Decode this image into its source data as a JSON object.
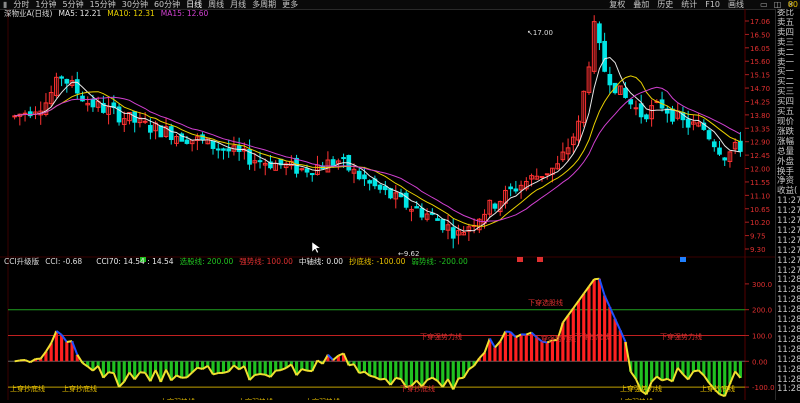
{
  "colors": {
    "bg": "#000000",
    "up": "#ff3232",
    "down": "#00e5e5",
    "ma5": "#e8e8e8",
    "ma10": "#e8d000",
    "ma15": "#d040d0",
    "cci_line": "#f0e030",
    "cci_blue": "#2050ff",
    "hist_up": "#ff2020",
    "hist_down": "#20c020",
    "level_green": "#20a020",
    "level_red": "#c02020"
  },
  "topbar": {
    "tabs": [
      "分时",
      "1分钟",
      "5分钟",
      "15分钟",
      "30分钟",
      "60分钟",
      "日线",
      "周线",
      "月线",
      "多周期",
      "更多"
    ],
    "active_tab": "日线",
    "tools": [
      "复权",
      "叠加",
      "历史",
      "统计",
      "F10",
      "画线"
    ]
  },
  "price_panel": {
    "title": "深物业A(日线)",
    "ma5_label": "MA5: 12.21",
    "ma10_label": "MA10: 12.31",
    "ma15_label": "MA15: 12.60",
    "high_marker": "17.00",
    "low_marker": "9.62",
    "y_ticks": [
      "17.06",
      "16.50",
      "16.05",
      "15.60",
      "15.15",
      "14.70",
      "14.25",
      "13.80",
      "13.35",
      "12.90",
      "12.45",
      "12.00",
      "11.55",
      "11.10",
      "10.65",
      "10.20",
      "9.75",
      "9.30"
    ]
  },
  "cci_panel": {
    "title": "CCI升级版",
    "cci_value": "CCI: -0.68",
    "cci70": "CCI70: 14.54 : 14.54",
    "label_xuangu": "选股线: 200.00",
    "label_qiangshi": "强势线: 100.00",
    "label_zhongzhou": "中轴线: 0.00",
    "label_chaodi": "抄底线: -100.00",
    "label_ruoshi": "弱势线: -200.00",
    "y_ticks": [
      "300.0",
      "200.0",
      "100.0",
      "0.00",
      "-100.0"
    ],
    "annotations": [
      {
        "text": "上穿抄底线",
        "color": "#e8c000"
      },
      {
        "text": "上穿抄底线",
        "color": "#e8c000"
      },
      {
        "text": "上穿弱势线",
        "color": "#e8c000"
      },
      {
        "text": "上穿弱势线",
        "color": "#e8c000"
      },
      {
        "text": "上穿弱势线",
        "color": "#e8c000"
      },
      {
        "text": "下穿抄底线",
        "color": "#e03030"
      },
      {
        "text": "下穿强势力线",
        "color": "#e03030"
      },
      {
        "text": "下穿选股线",
        "color": "#e03030"
      },
      {
        "text": "下穿强势力线",
        "color": "#e03030"
      },
      {
        "text": "下穿抄底线",
        "color": "#e03030"
      },
      {
        "text": "上穿强势力线",
        "color": "#e8c000"
      },
      {
        "text": "上穿弱势线",
        "color": "#e8c000"
      },
      {
        "text": "下穿强势力线",
        "color": "#e03030"
      },
      {
        "text": "上穿抄底线",
        "color": "#e8c000"
      }
    ]
  },
  "right_panel": {
    "corner": "00",
    "rows": [
      {
        "t": "委比",
        "red": false
      },
      {
        "t": "卖五",
        "red": false
      },
      {
        "t": "卖四",
        "red": false
      },
      {
        "t": "卖三",
        "red": false
      },
      {
        "t": "卖二",
        "red": false
      },
      {
        "t": "卖一",
        "red": false
      },
      {
        "t": "买一",
        "red": false
      },
      {
        "t": "买二",
        "red": false
      },
      {
        "t": "买三",
        "red": false
      },
      {
        "t": "买四",
        "red": false
      },
      {
        "t": "买五",
        "red": false
      },
      {
        "t": "现价",
        "red": false
      },
      {
        "t": "涨跌",
        "red": false
      },
      {
        "t": "涨幅",
        "red": false
      },
      {
        "t": "总量",
        "red": false
      },
      {
        "t": "外盘",
        "red": false
      },
      {
        "t": "换手",
        "red": false
      },
      {
        "t": "净资",
        "red": false
      },
      {
        "t": "收益(",
        "red": false
      },
      {
        "t": "11:27",
        "red": false
      },
      {
        "t": "11:27",
        "red": false
      },
      {
        "t": "11:27",
        "red": false
      },
      {
        "t": "11:27",
        "red": false
      },
      {
        "t": "11:27",
        "red": false
      },
      {
        "t": "11:27",
        "red": false
      },
      {
        "t": "11:27",
        "red": false
      },
      {
        "t": "11:27",
        "red": false
      },
      {
        "t": "11:28",
        "red": false
      },
      {
        "t": "11:28",
        "red": false
      },
      {
        "t": "11:28",
        "red": false
      },
      {
        "t": "11:28",
        "red": false
      },
      {
        "t": "11:28",
        "red": false
      },
      {
        "t": "11:28",
        "red": false
      },
      {
        "t": "11:28",
        "red": false
      },
      {
        "t": "11:28",
        "red": false
      },
      {
        "t": "11:28",
        "red": false
      },
      {
        "t": "11:28",
        "red": false
      },
      {
        "t": "11:28",
        "red": false
      },
      {
        "t": "11:28",
        "red": false
      }
    ]
  }
}
